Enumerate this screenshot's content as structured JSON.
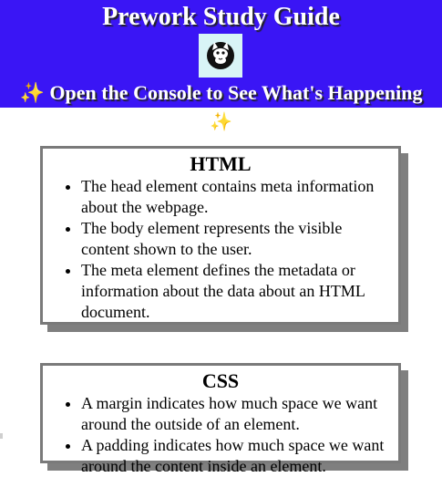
{
  "header": {
    "title": "Prework Study Guide",
    "logo_icon": "cat-icon",
    "subtitle_sparkle": "✨",
    "subtitle": "Open the Console to See What's Happening",
    "sparkle_below": "✨",
    "background_color": "#3a15f5",
    "logo_background": "#d8f4f6"
  },
  "sections": [
    {
      "heading": "HTML",
      "items": [
        "The head element contains meta information about the webpage.",
        "The body element represents the visible content shown to the user.",
        "The meta element defines the metadata or information about the data about an HTML document."
      ]
    },
    {
      "heading": "CSS",
      "items": [
        "A margin indicates how much space we want around the outside of an element.",
        "A padding indicates how much space we want around the content inside an element."
      ]
    }
  ]
}
